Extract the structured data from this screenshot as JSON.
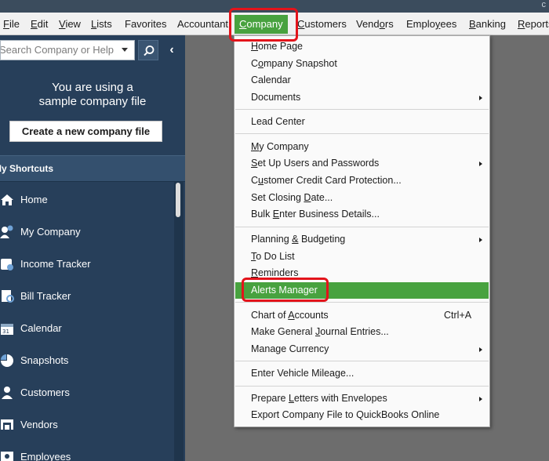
{
  "menubar": {
    "items": [
      {
        "label": "File"
      },
      {
        "label": "Edit"
      },
      {
        "label": "View"
      },
      {
        "label": "Lists"
      },
      {
        "label": "Favorites"
      },
      {
        "label": "Accountant"
      },
      {
        "label": "Company"
      },
      {
        "label": "Customers"
      },
      {
        "label": "Vendors"
      },
      {
        "label": "Employees"
      },
      {
        "label": "Banking"
      },
      {
        "label": "Reports"
      }
    ]
  },
  "sidebar": {
    "search_placeholder": "Search Company or Help",
    "sample_text": "You are using a sample company file",
    "create_button": "Create a new company file",
    "shortcuts_header": "My Shortcuts",
    "items": [
      {
        "label": "Home",
        "icon": "home-icon"
      },
      {
        "label": "My Company",
        "icon": "company-icon"
      },
      {
        "label": "Income Tracker",
        "icon": "income-tracker-icon"
      },
      {
        "label": "Bill Tracker",
        "icon": "bill-tracker-icon"
      },
      {
        "label": "Calendar",
        "icon": "calendar-icon"
      },
      {
        "label": "Snapshots",
        "icon": "snapshots-icon"
      },
      {
        "label": "Customers",
        "icon": "customers-icon"
      },
      {
        "label": "Vendors",
        "icon": "vendors-icon"
      },
      {
        "label": "Employees",
        "icon": "employees-icon"
      }
    ]
  },
  "company_menu": {
    "items": [
      {
        "label": "Home Page"
      },
      {
        "label": "Company Snapshot"
      },
      {
        "label": "Calendar"
      },
      {
        "label": "Documents"
      },
      {
        "label": "Lead Center"
      },
      {
        "label": "My Company"
      },
      {
        "label": "Set Up Users and Passwords"
      },
      {
        "label": "Customer Credit Card Protection..."
      },
      {
        "label": "Set Closing Date..."
      },
      {
        "label": "Bulk Enter Business Details..."
      },
      {
        "label": "Planning & Budgeting"
      },
      {
        "label": "To Do List"
      },
      {
        "label": "Reminders"
      },
      {
        "label": "Alerts Manager"
      },
      {
        "label": "Chart of Accounts",
        "shortcut": "Ctrl+A"
      },
      {
        "label": "Make General Journal Entries..."
      },
      {
        "label": "Manage Currency"
      },
      {
        "label": "Enter Vehicle Mileage..."
      },
      {
        "label": "Prepare Letters with Envelopes"
      },
      {
        "label": "Export Company File to QuickBooks Online"
      }
    ]
  },
  "colors": {
    "menu_highlight": "#48a23f",
    "sidebar_bg": "#273f5a",
    "annotation_red": "#e3141b"
  }
}
